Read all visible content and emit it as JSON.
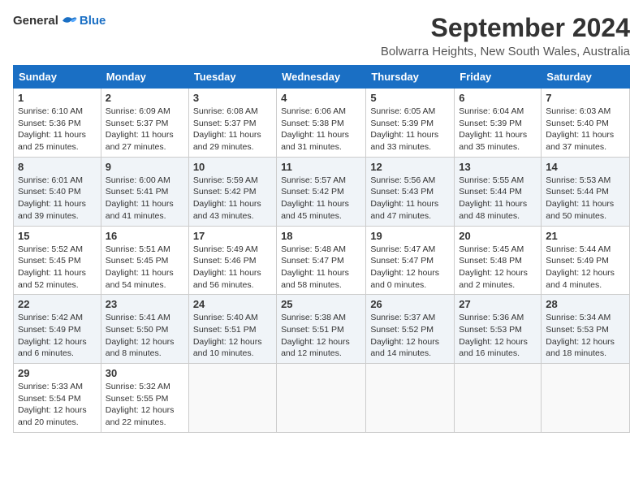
{
  "logo": {
    "text_general": "General",
    "text_blue": "Blue"
  },
  "header": {
    "month_title": "September 2024",
    "location": "Bolwarra Heights, New South Wales, Australia"
  },
  "days_of_week": [
    "Sunday",
    "Monday",
    "Tuesday",
    "Wednesday",
    "Thursday",
    "Friday",
    "Saturday"
  ],
  "weeks": [
    [
      {
        "day": "1",
        "sunrise": "6:10 AM",
        "sunset": "5:36 PM",
        "daylight": "11 hours and 25 minutes."
      },
      {
        "day": "2",
        "sunrise": "6:09 AM",
        "sunset": "5:37 PM",
        "daylight": "11 hours and 27 minutes."
      },
      {
        "day": "3",
        "sunrise": "6:08 AM",
        "sunset": "5:37 PM",
        "daylight": "11 hours and 29 minutes."
      },
      {
        "day": "4",
        "sunrise": "6:06 AM",
        "sunset": "5:38 PM",
        "daylight": "11 hours and 31 minutes."
      },
      {
        "day": "5",
        "sunrise": "6:05 AM",
        "sunset": "5:39 PM",
        "daylight": "11 hours and 33 minutes."
      },
      {
        "day": "6",
        "sunrise": "6:04 AM",
        "sunset": "5:39 PM",
        "daylight": "11 hours and 35 minutes."
      },
      {
        "day": "7",
        "sunrise": "6:03 AM",
        "sunset": "5:40 PM",
        "daylight": "11 hours and 37 minutes."
      }
    ],
    [
      {
        "day": "8",
        "sunrise": "6:01 AM",
        "sunset": "5:40 PM",
        "daylight": "11 hours and 39 minutes."
      },
      {
        "day": "9",
        "sunrise": "6:00 AM",
        "sunset": "5:41 PM",
        "daylight": "11 hours and 41 minutes."
      },
      {
        "day": "10",
        "sunrise": "5:59 AM",
        "sunset": "5:42 PM",
        "daylight": "11 hours and 43 minutes."
      },
      {
        "day": "11",
        "sunrise": "5:57 AM",
        "sunset": "5:42 PM",
        "daylight": "11 hours and 45 minutes."
      },
      {
        "day": "12",
        "sunrise": "5:56 AM",
        "sunset": "5:43 PM",
        "daylight": "11 hours and 47 minutes."
      },
      {
        "day": "13",
        "sunrise": "5:55 AM",
        "sunset": "5:44 PM",
        "daylight": "11 hours and 48 minutes."
      },
      {
        "day": "14",
        "sunrise": "5:53 AM",
        "sunset": "5:44 PM",
        "daylight": "11 hours and 50 minutes."
      }
    ],
    [
      {
        "day": "15",
        "sunrise": "5:52 AM",
        "sunset": "5:45 PM",
        "daylight": "11 hours and 52 minutes."
      },
      {
        "day": "16",
        "sunrise": "5:51 AM",
        "sunset": "5:45 PM",
        "daylight": "11 hours and 54 minutes."
      },
      {
        "day": "17",
        "sunrise": "5:49 AM",
        "sunset": "5:46 PM",
        "daylight": "11 hours and 56 minutes."
      },
      {
        "day": "18",
        "sunrise": "5:48 AM",
        "sunset": "5:47 PM",
        "daylight": "11 hours and 58 minutes."
      },
      {
        "day": "19",
        "sunrise": "5:47 AM",
        "sunset": "5:47 PM",
        "daylight": "12 hours and 0 minutes."
      },
      {
        "day": "20",
        "sunrise": "5:45 AM",
        "sunset": "5:48 PM",
        "daylight": "12 hours and 2 minutes."
      },
      {
        "day": "21",
        "sunrise": "5:44 AM",
        "sunset": "5:49 PM",
        "daylight": "12 hours and 4 minutes."
      }
    ],
    [
      {
        "day": "22",
        "sunrise": "5:42 AM",
        "sunset": "5:49 PM",
        "daylight": "12 hours and 6 minutes."
      },
      {
        "day": "23",
        "sunrise": "5:41 AM",
        "sunset": "5:50 PM",
        "daylight": "12 hours and 8 minutes."
      },
      {
        "day": "24",
        "sunrise": "5:40 AM",
        "sunset": "5:51 PM",
        "daylight": "12 hours and 10 minutes."
      },
      {
        "day": "25",
        "sunrise": "5:38 AM",
        "sunset": "5:51 PM",
        "daylight": "12 hours and 12 minutes."
      },
      {
        "day": "26",
        "sunrise": "5:37 AM",
        "sunset": "5:52 PM",
        "daylight": "12 hours and 14 minutes."
      },
      {
        "day": "27",
        "sunrise": "5:36 AM",
        "sunset": "5:53 PM",
        "daylight": "12 hours and 16 minutes."
      },
      {
        "day": "28",
        "sunrise": "5:34 AM",
        "sunset": "5:53 PM",
        "daylight": "12 hours and 18 minutes."
      }
    ],
    [
      {
        "day": "29",
        "sunrise": "5:33 AM",
        "sunset": "5:54 PM",
        "daylight": "12 hours and 20 minutes."
      },
      {
        "day": "30",
        "sunrise": "5:32 AM",
        "sunset": "5:55 PM",
        "daylight": "12 hours and 22 minutes."
      },
      null,
      null,
      null,
      null,
      null
    ]
  ]
}
